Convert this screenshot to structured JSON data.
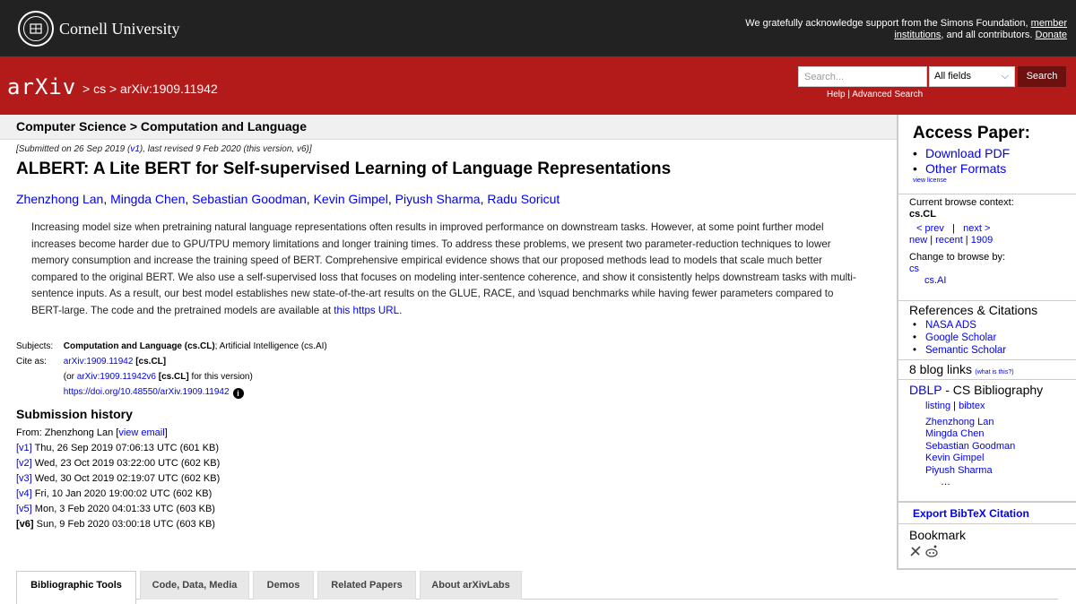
{
  "cornell": {
    "wordmark": "Cornell University",
    "support_line1": "We gratefully acknowledge support from the Simons Foundation, ",
    "support_link1": "member institutions",
    "support_line2": ", and all contributors. ",
    "support_link2": "Donate"
  },
  "header": {
    "logo": "arXiv",
    "crumb_sep": ">",
    "crumb_cs": "cs",
    "crumb_id": "arXiv:1909.11942",
    "search_placeholder": "Search...",
    "field_select": "All fields",
    "search_button": "Search",
    "help": "Help",
    "advanced": "Advanced Search"
  },
  "main": {
    "context": "Computer Science > Computation and Language",
    "submitted": "[Submitted on 26 Sep 2019 (",
    "submitted_v1": "v1",
    "submitted_rest": "), last revised 9 Feb 2020 (this version, v6)]",
    "title": "ALBERT: A Lite BERT for Self-supervised Learning of Language Representations",
    "authors": [
      "Zhenzhong Lan",
      "Mingda Chen",
      "Sebastian Goodman",
      "Kevin Gimpel",
      "Piyush Sharma",
      "Radu Soricut"
    ],
    "abstract": "Increasing model size when pretraining natural language representations often results in improved performance on downstream tasks. However, at some point further model increases become harder due to GPU/TPU memory limitations and longer training times. To address these problems, we present two parameter-reduction techniques to lower memory consumption and increase the training speed of BERT. Comprehensive empirical evidence shows that our proposed methods lead to models that scale much better compared to the original BERT. We also use a self-supervised loss that focuses on modeling inter-sentence coherence, and show it consistently helps downstream tasks with multi-sentence inputs. As a result, our best model establishes new state-of-the-art results on the GLUE, RACE, and \\squad benchmarks while having fewer parameters compared to BERT-large. The code and the pretrained models are available at ",
    "abstract_link": "this https URL",
    "subjects_label": "Subjects:",
    "subjects_primary": "Computation and Language (cs.CL)",
    "subjects_rest": "; Artificial Intelligence (cs.AI)",
    "cite_label": "Cite as:",
    "cite_id": "arXiv:1909.11942",
    "cite_tag": "[cs.CL]",
    "cite_or": "(or ",
    "cite_v6": "arXiv:1909.11942v6",
    "cite_v6_tag": "[cs.CL]",
    "cite_v6_rest": " for this version)",
    "doi": "https://doi.org/10.48550/arXiv.1909.11942",
    "history_title": "Submission history",
    "history_from": "From: Zhenzhong Lan [",
    "history_email": "view email",
    "history_from_end": "]",
    "versions": [
      {
        "v": "[v1]",
        "date": " Thu, 26 Sep 2019 07:06:13 UTC (601 KB)"
      },
      {
        "v": "[v2]",
        "date": " Wed, 23 Oct 2019 03:22:00 UTC (602 KB)"
      },
      {
        "v": "[v3]",
        "date": " Wed, 30 Oct 2019 02:19:07 UTC (602 KB)"
      },
      {
        "v": "[v4]",
        "date": " Fri, 10 Jan 2020 19:00:02 UTC (602 KB)"
      },
      {
        "v": "[v5]",
        "date": " Mon, 3 Feb 2020 04:01:33 UTC (603 KB)"
      },
      {
        "v": "[v6]",
        "date": " Sun, 9 Feb 2020 03:00:18 UTC (603 KB)"
      }
    ]
  },
  "tabs": [
    "Bibliographic Tools",
    "Code, Data, Media",
    "Demos",
    "Related Papers",
    "About arXivLabs"
  ],
  "sidebar": {
    "access_title": "Access Paper:",
    "download_pdf": "Download PDF",
    "other_formats": "Other Formats",
    "view_license": "view license",
    "browse_context_label": "Current browse context:",
    "browse_context": "cs.CL",
    "prev": "< prev",
    "pipe": "|",
    "next": "next >",
    "new": "new",
    "recent": "recent",
    "year": "1909",
    "change_browse": "Change to browse by:",
    "browse_cs": "cs",
    "browse_csai": "cs.AI",
    "refs_title": "References & Citations",
    "refs": [
      "NASA ADS",
      "Google Scholar",
      "Semantic Scholar"
    ],
    "blog_links": "8 blog links",
    "blog_what": "(what is this?)",
    "dblp_title": "DBLP",
    "dblp_rest": " - CS Bibliography",
    "listing": "listing",
    "bibtex": "bibtex",
    "dblp_authors": [
      "Zhenzhong Lan",
      "Mingda Chen",
      "Sebastian Goodman",
      "Kevin Gimpel",
      "Piyush Sharma"
    ],
    "ellipsis": "…",
    "export_bibtex": "Export BibTeX Citation",
    "bookmark": "Bookmark"
  }
}
